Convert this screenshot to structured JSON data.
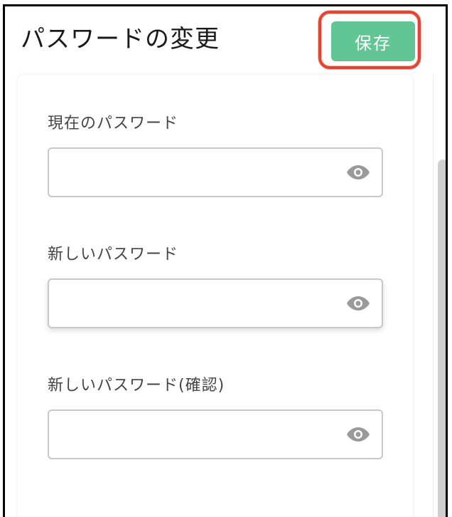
{
  "header": {
    "title": "パスワードの変更",
    "save_label": "保存"
  },
  "form": {
    "fields": [
      {
        "label": "現在のパスワード",
        "value": "",
        "icon": "eye-icon"
      },
      {
        "label": "新しいパスワード",
        "value": "",
        "icon": "eye-icon"
      },
      {
        "label": "新しいパスワード(確認)",
        "value": "",
        "icon": "eye-icon"
      }
    ]
  },
  "colors": {
    "save_button": "#62c694",
    "highlight": "#e0452f",
    "icon": "#9a9a9a"
  }
}
